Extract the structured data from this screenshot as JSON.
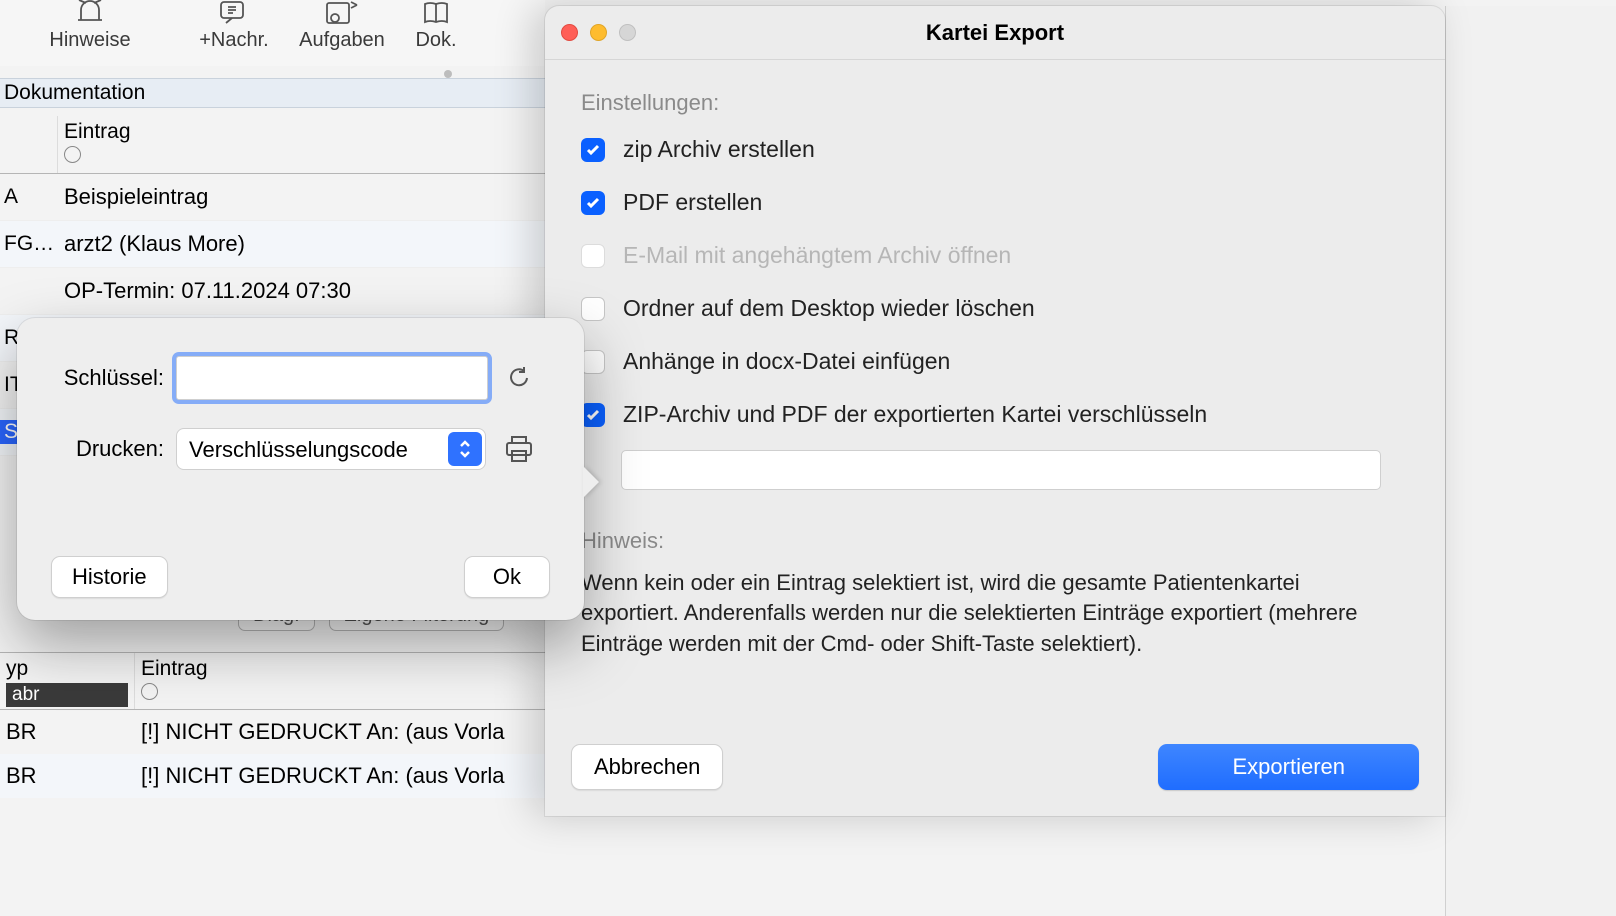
{
  "toolbar": {
    "items": [
      {
        "label": "Hinweise"
      },
      {
        "label": "+Nachr."
      },
      {
        "label": "Aufgaben"
      },
      {
        "label": "Dok."
      }
    ]
  },
  "dokumentation_header": "Dokumentation",
  "col_header_eintrag": "Eintrag",
  "rows": [
    {
      "code": "A",
      "text": "Beispieleintrag"
    },
    {
      "code": "FG…",
      "text": "arzt2 (Klaus More)"
    },
    {
      "code": "",
      "text": "OP-Termin: 07.11.2024 07:30"
    },
    {
      "code": "R",
      "text": ""
    },
    {
      "code": "IT",
      "text": ""
    },
    {
      "code": "S",
      "text": ""
    }
  ],
  "popover": {
    "key_label": "Schlüssel:",
    "key_value": "",
    "print_label": "Drucken:",
    "print_selected": "Verschlüsselungscode",
    "history_btn": "Historie",
    "ok_btn": "Ok"
  },
  "filters": {
    "diag": "Diag.",
    "eigene": "Eigene Filterung"
  },
  "lower": {
    "col1_header": "yp",
    "col1_filter_value": "abr",
    "col2_header": "Eintrag",
    "rows": [
      {
        "c1": "BR",
        "c2": "[!] NICHT GEDRUCKT An:   (aus Vorla"
      },
      {
        "c1": "BR",
        "c2": "[!] NICHT GEDRUCKT An:   (aus Vorla"
      }
    ]
  },
  "export": {
    "title": "Kartei Export",
    "settings_label": "Einstellungen:",
    "opt_zip": "zip Archiv erstellen",
    "opt_pdf": "PDF erstellen",
    "opt_email": "E-Mail mit angehängtem Archiv öffnen",
    "opt_delete": "Ordner auf dem Desktop wieder löschen",
    "opt_docx": "Anhänge in docx-Datei einfügen",
    "opt_encrypt": "ZIP-Archiv und PDF der exportierten Kartei verschlüsseln",
    "encrypt_value": "",
    "hint_label": "Hinweis:",
    "hint_text": "Wenn kein oder ein Eintrag selektiert ist, wird die gesamte Patientenkartei exportiert. Anderenfalls werden nur die selektierten Einträge exportiert (mehrere Einträge werden mit der Cmd- oder Shift-Taste selektiert).",
    "cancel": "Abbrechen",
    "export_btn": "Exportieren"
  }
}
